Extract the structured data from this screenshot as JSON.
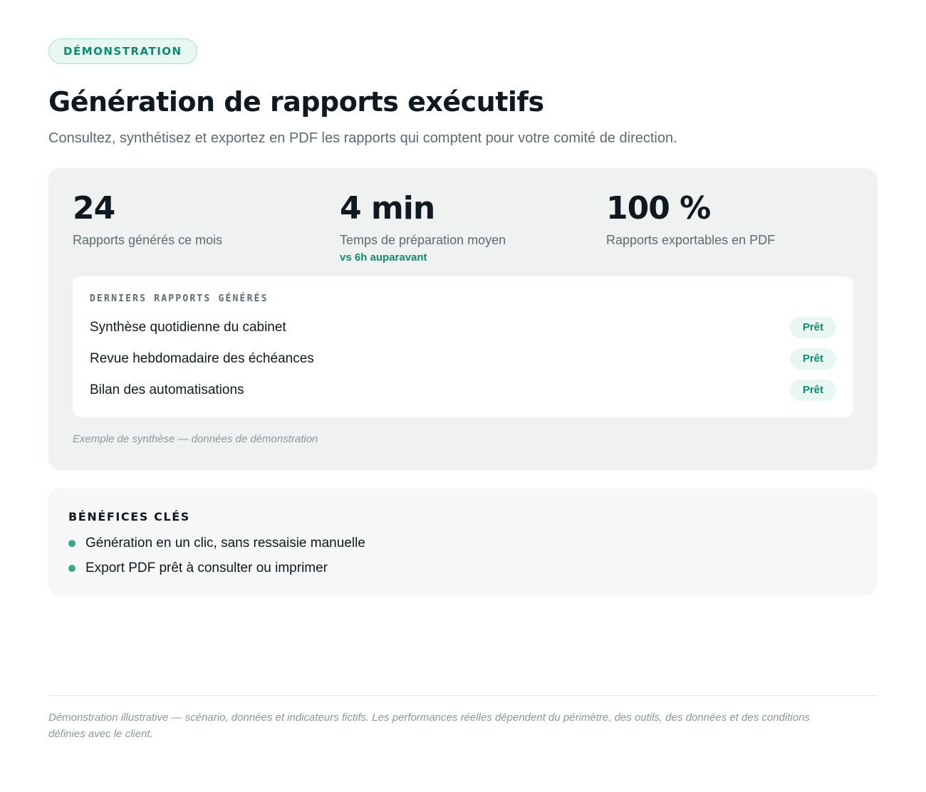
{
  "header": {
    "badge": "DÉMONSTRATION",
    "title": "Génération de rapports exécutifs",
    "subtitle": "Consultez, synthétisez et exportez en PDF les rapports qui comptent pour votre comité de direction."
  },
  "stats": [
    {
      "value": "24",
      "label": "Rapports générés ce mois",
      "note": ""
    },
    {
      "value": "4 min",
      "label": "Temps de préparation moyen",
      "note": "vs 6h auparavant"
    },
    {
      "value": "100 %",
      "label": "Rapports exportables en PDF",
      "note": ""
    }
  ],
  "reports": {
    "heading": "DERNIERS RAPPORTS GÉNÉRÉS",
    "items": [
      {
        "name": "Synthèse quotidienne du cabinet",
        "status": "Prêt"
      },
      {
        "name": "Revue hebdomadaire des échéances",
        "status": "Prêt"
      },
      {
        "name": "Bilan des automatisations",
        "status": "Prêt"
      }
    ],
    "caption": "Exemple de synthèse — données de démonstration"
  },
  "benefits": {
    "heading": "BÉNÉFICES CLÉS",
    "items": [
      "Génération en un clic, sans ressaisie manuelle",
      "Export PDF prêt à consulter ou imprimer"
    ]
  },
  "footer": {
    "disclaimer": "Démonstration illustrative — scénario, données et indicateurs fictifs. Les performances réelles dépendent du périmètre, des outils, des données et des conditions définies avec le client."
  },
  "colors": {
    "accent": "#0f8a6e",
    "bullet": "#3aa68e",
    "badge_bg": "#e8f7f2",
    "card_bg": "#f0f2f1"
  }
}
